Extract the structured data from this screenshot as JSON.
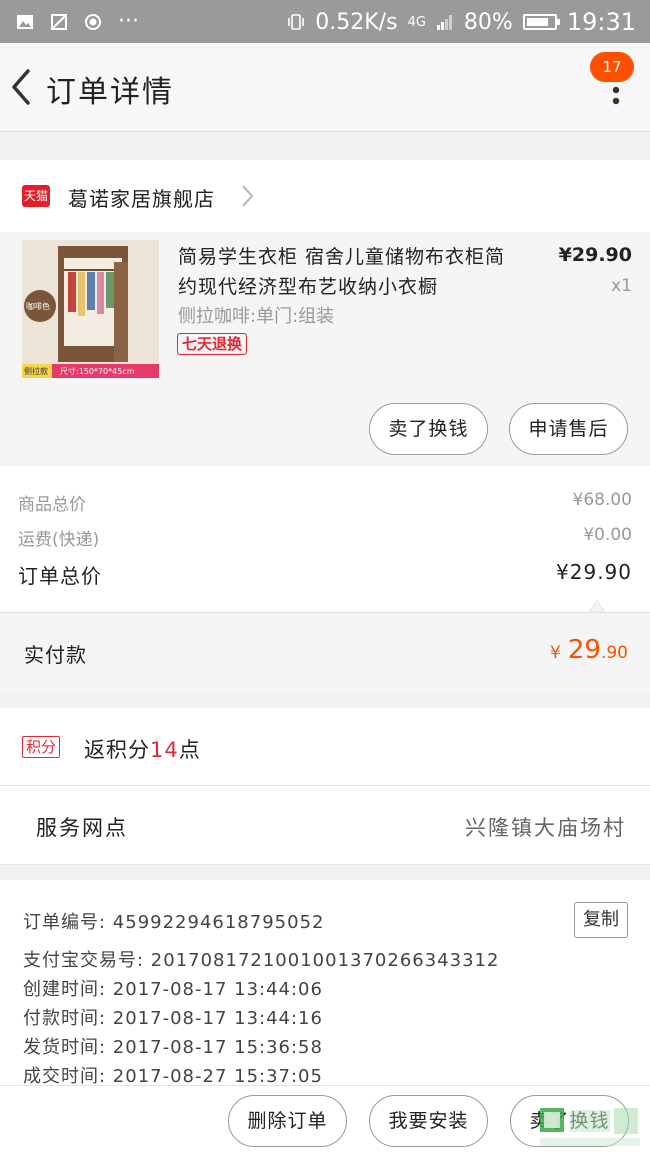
{
  "status_bar": {
    "speed": "0.52K/s",
    "network": "4G",
    "battery_percent": "80%",
    "time": "19:31",
    "battery_level": 0.8
  },
  "header": {
    "title": "订单详情",
    "badge_count": "17"
  },
  "store": {
    "logo_text": "天猫",
    "name": "葛诺家居旗舰店"
  },
  "product": {
    "title": "简易学生衣柜 宿舍儿童储物布衣柜简约现代经济型布艺收纳小衣橱",
    "sku": "侧拉咖啡:单门:组装",
    "return_tag": "七天退换",
    "price": "¥29.90",
    "quantity": "x1",
    "thumb": {
      "color_label": "咖啡色",
      "tag_left": "侧拉款",
      "tag_size": "尺寸:150*70*45cm"
    },
    "buttons": {
      "sell_exchange": "卖了换钱",
      "after_sale": "申请售后"
    }
  },
  "totals": {
    "goods_total_label": "商品总价",
    "goods_total_value": "¥68.00",
    "shipping_label": "运费(快递)",
    "shipping_value": "¥0.00",
    "order_total_label": "订单总价",
    "order_total_value": "¥29.90"
  },
  "paid": {
    "label": "实付款",
    "currency": "¥",
    "integer": "29",
    "decimal": ".90"
  },
  "points": {
    "tag": "积分",
    "prefix": "返积分",
    "amount": "14",
    "suffix": "点"
  },
  "service": {
    "label": "服务网点",
    "value": "兴隆镇大庙场村"
  },
  "order_info": {
    "copy_label": "复制",
    "lines": [
      "订单编号: 45992294618795052",
      "支付宝交易号: 2017081721001001370266343312",
      "创建时间: 2017-08-17 13:44:06",
      "付款时间: 2017-08-17 13:44:16",
      "发货时间: 2017-08-17 15:36:58",
      "成交时间: 2017-08-27 15:37:05"
    ]
  },
  "bottom_bar": {
    "delete_order": "删除订单",
    "install": "我要安装",
    "sell_exchange": "卖了换钱"
  },
  "colors": {
    "accent": "#ff5000",
    "tmall_red": "#e61e2b",
    "tag_red": "#e4283a"
  }
}
